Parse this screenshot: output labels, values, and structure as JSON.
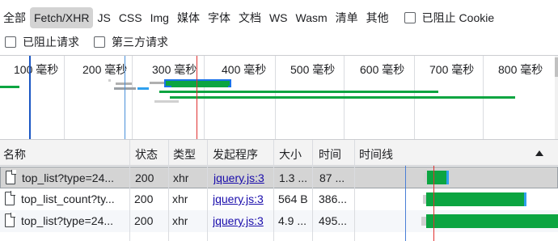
{
  "filters": {
    "types": [
      "全部",
      "Fetch/XHR",
      "JS",
      "CSS",
      "Img",
      "媒体",
      "字体",
      "文档",
      "WS",
      "Wasm",
      "清单",
      "其他"
    ],
    "active_index": 1,
    "blocked_cookies_label": "已阻止 Cookie",
    "blocked_requests_label": "已阻止请求",
    "third_party_label": "第三方请求"
  },
  "overview": {
    "ticks": [
      "100 毫秒",
      "200 毫秒",
      "300 毫秒",
      "400 毫秒",
      "500 毫秒",
      "600 毫秒",
      "700 毫秒",
      "800 毫秒"
    ]
  },
  "table": {
    "columns": {
      "name": "名称",
      "status": "状态",
      "type": "类型",
      "initiator": "发起程序",
      "size": "大小",
      "time": "时间",
      "waterfall": "时间线"
    },
    "rows": [
      {
        "name": "top_list?type=24...",
        "status": "200",
        "type": "xhr",
        "initiator": "jquery.js:3",
        "size": "1.3 ...",
        "time": "87 ..."
      },
      {
        "name": "top_list_count?ty...",
        "status": "200",
        "type": "xhr",
        "initiator": "jquery.js:3",
        "size": "564 B",
        "time": "386..."
      },
      {
        "name": "top_list?type=24...",
        "status": "200",
        "type": "xhr",
        "initiator": "jquery.js:3",
        "size": "4.9 ...",
        "time": "495..."
      }
    ]
  },
  "colors": {
    "receiving": "#0ca541",
    "dom_content_loaded": "#1a56c4",
    "load": "#e03131",
    "waiting": "#d0d0d0"
  }
}
